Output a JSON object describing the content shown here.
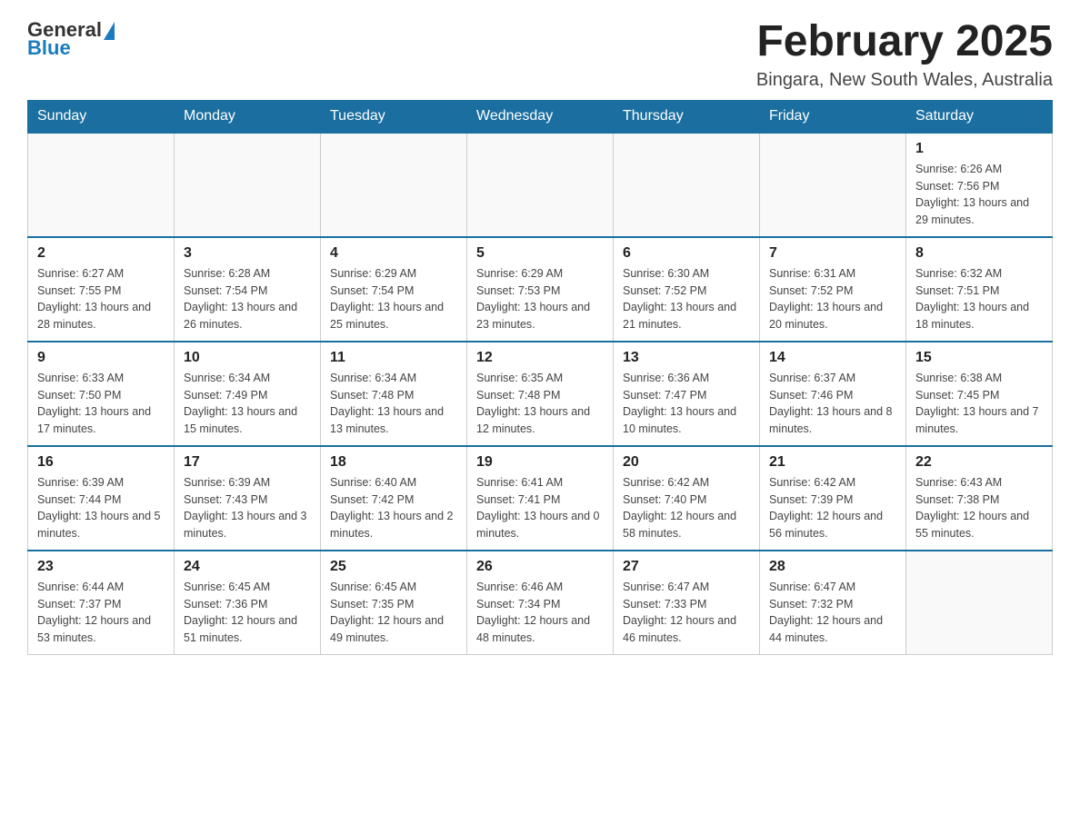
{
  "header": {
    "logo": {
      "text_general": "General",
      "text_blue": "Blue",
      "aria": "GeneralBlue logo"
    },
    "title": "February 2025",
    "location": "Bingara, New South Wales, Australia"
  },
  "calendar": {
    "days_of_week": [
      "Sunday",
      "Monday",
      "Tuesday",
      "Wednesday",
      "Thursday",
      "Friday",
      "Saturday"
    ],
    "weeks": [
      [
        {
          "day": "",
          "info": ""
        },
        {
          "day": "",
          "info": ""
        },
        {
          "day": "",
          "info": ""
        },
        {
          "day": "",
          "info": ""
        },
        {
          "day": "",
          "info": ""
        },
        {
          "day": "",
          "info": ""
        },
        {
          "day": "1",
          "info": "Sunrise: 6:26 AM\nSunset: 7:56 PM\nDaylight: 13 hours and 29 minutes."
        }
      ],
      [
        {
          "day": "2",
          "info": "Sunrise: 6:27 AM\nSunset: 7:55 PM\nDaylight: 13 hours and 28 minutes."
        },
        {
          "day": "3",
          "info": "Sunrise: 6:28 AM\nSunset: 7:54 PM\nDaylight: 13 hours and 26 minutes."
        },
        {
          "day": "4",
          "info": "Sunrise: 6:29 AM\nSunset: 7:54 PM\nDaylight: 13 hours and 25 minutes."
        },
        {
          "day": "5",
          "info": "Sunrise: 6:29 AM\nSunset: 7:53 PM\nDaylight: 13 hours and 23 minutes."
        },
        {
          "day": "6",
          "info": "Sunrise: 6:30 AM\nSunset: 7:52 PM\nDaylight: 13 hours and 21 minutes."
        },
        {
          "day": "7",
          "info": "Sunrise: 6:31 AM\nSunset: 7:52 PM\nDaylight: 13 hours and 20 minutes."
        },
        {
          "day": "8",
          "info": "Sunrise: 6:32 AM\nSunset: 7:51 PM\nDaylight: 13 hours and 18 minutes."
        }
      ],
      [
        {
          "day": "9",
          "info": "Sunrise: 6:33 AM\nSunset: 7:50 PM\nDaylight: 13 hours and 17 minutes."
        },
        {
          "day": "10",
          "info": "Sunrise: 6:34 AM\nSunset: 7:49 PM\nDaylight: 13 hours and 15 minutes."
        },
        {
          "day": "11",
          "info": "Sunrise: 6:34 AM\nSunset: 7:48 PM\nDaylight: 13 hours and 13 minutes."
        },
        {
          "day": "12",
          "info": "Sunrise: 6:35 AM\nSunset: 7:48 PM\nDaylight: 13 hours and 12 minutes."
        },
        {
          "day": "13",
          "info": "Sunrise: 6:36 AM\nSunset: 7:47 PM\nDaylight: 13 hours and 10 minutes."
        },
        {
          "day": "14",
          "info": "Sunrise: 6:37 AM\nSunset: 7:46 PM\nDaylight: 13 hours and 8 minutes."
        },
        {
          "day": "15",
          "info": "Sunrise: 6:38 AM\nSunset: 7:45 PM\nDaylight: 13 hours and 7 minutes."
        }
      ],
      [
        {
          "day": "16",
          "info": "Sunrise: 6:39 AM\nSunset: 7:44 PM\nDaylight: 13 hours and 5 minutes."
        },
        {
          "day": "17",
          "info": "Sunrise: 6:39 AM\nSunset: 7:43 PM\nDaylight: 13 hours and 3 minutes."
        },
        {
          "day": "18",
          "info": "Sunrise: 6:40 AM\nSunset: 7:42 PM\nDaylight: 13 hours and 2 minutes."
        },
        {
          "day": "19",
          "info": "Sunrise: 6:41 AM\nSunset: 7:41 PM\nDaylight: 13 hours and 0 minutes."
        },
        {
          "day": "20",
          "info": "Sunrise: 6:42 AM\nSunset: 7:40 PM\nDaylight: 12 hours and 58 minutes."
        },
        {
          "day": "21",
          "info": "Sunrise: 6:42 AM\nSunset: 7:39 PM\nDaylight: 12 hours and 56 minutes."
        },
        {
          "day": "22",
          "info": "Sunrise: 6:43 AM\nSunset: 7:38 PM\nDaylight: 12 hours and 55 minutes."
        }
      ],
      [
        {
          "day": "23",
          "info": "Sunrise: 6:44 AM\nSunset: 7:37 PM\nDaylight: 12 hours and 53 minutes."
        },
        {
          "day": "24",
          "info": "Sunrise: 6:45 AM\nSunset: 7:36 PM\nDaylight: 12 hours and 51 minutes."
        },
        {
          "day": "25",
          "info": "Sunrise: 6:45 AM\nSunset: 7:35 PM\nDaylight: 12 hours and 49 minutes."
        },
        {
          "day": "26",
          "info": "Sunrise: 6:46 AM\nSunset: 7:34 PM\nDaylight: 12 hours and 48 minutes."
        },
        {
          "day": "27",
          "info": "Sunrise: 6:47 AM\nSunset: 7:33 PM\nDaylight: 12 hours and 46 minutes."
        },
        {
          "day": "28",
          "info": "Sunrise: 6:47 AM\nSunset: 7:32 PM\nDaylight: 12 hours and 44 minutes."
        },
        {
          "day": "",
          "info": ""
        }
      ]
    ]
  }
}
